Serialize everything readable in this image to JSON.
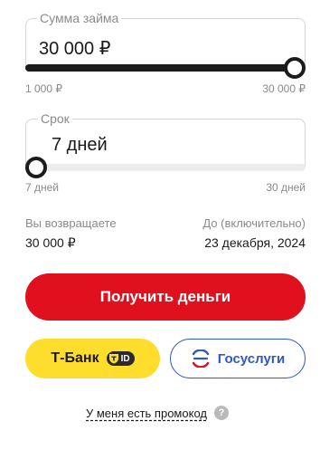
{
  "amount": {
    "label": "Сумма займа",
    "value": "30 000 ₽",
    "min_label": "1 000 ₽",
    "max_label": "30 000 ₽",
    "slider_fraction": 1.0
  },
  "term": {
    "label": "Срок",
    "value": "7 дней",
    "min_label": "7 дней",
    "max_label": "30 дней",
    "slider_fraction": 0.0
  },
  "summary": {
    "return_label": "Вы возвращаете",
    "return_value": "30 000 ₽",
    "due_label": "До (включительно)",
    "due_value": "23 декабря, 2024"
  },
  "actions": {
    "primary_label": "Получить деньги",
    "tbank_label": "Т-Банк",
    "tbank_badge": "ID",
    "gosuslugi_label": "Госуслуги",
    "promo_label": "У меня есть промокод",
    "help_symbol": "?"
  },
  "colors": {
    "primary": "#e0101e",
    "tbank": "#ffdd2d",
    "gosuslugi": "#2f57c6"
  },
  "icons": {
    "tbank": "tbank-shield-icon",
    "gosuslugi": "gosuslugi-logo-icon",
    "help": "question-circle-icon"
  }
}
